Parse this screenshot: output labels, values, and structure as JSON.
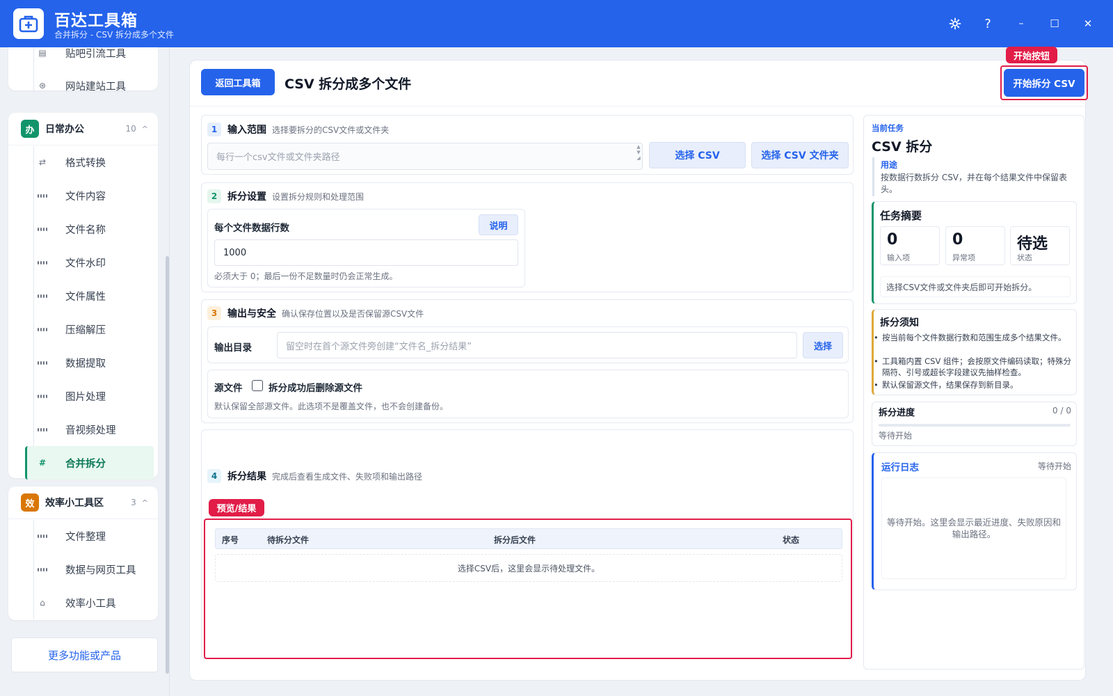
{
  "titlebar": {
    "title": "百达工具箱",
    "subtitle": "合并拆分 - CSV 拆分成多个文件",
    "help_label": "?",
    "minimize_label": "–",
    "maximize_label": "☐",
    "close_label": "✕"
  },
  "sidebar": {
    "top_group": {
      "items": [
        {
          "label": "贴吧引流工具"
        },
        {
          "label": "网站建站工具"
        }
      ]
    },
    "office_group": {
      "badge": "办",
      "title": "日常办公",
      "count": "10",
      "chevron": "^",
      "items": [
        {
          "label": "格式转换",
          "icon": "swap-icon"
        },
        {
          "label": "文件内容",
          "icon": "grid-icon"
        },
        {
          "label": "文件名称",
          "icon": "grid-icon"
        },
        {
          "label": "文件水印",
          "icon": "grid-icon"
        },
        {
          "label": "文件属性",
          "icon": "grid-icon"
        },
        {
          "label": "压缩解压",
          "icon": "grid-icon"
        },
        {
          "label": "数据提取",
          "icon": "grid-icon"
        },
        {
          "label": "图片处理",
          "icon": "grid-icon"
        },
        {
          "label": "音视频处理",
          "icon": "grid-icon"
        },
        {
          "label": "合并拆分",
          "icon": "hash-icon",
          "active": true
        }
      ]
    },
    "efficiency_group": {
      "badge": "效",
      "title": "效率小工具区",
      "count": "3",
      "chevron": "^",
      "items": [
        {
          "label": "文件整理",
          "icon": "grid-icon"
        },
        {
          "label": "数据与网页工具",
          "icon": "grid-icon"
        },
        {
          "label": "效率小工具",
          "icon": "toolbox-icon"
        }
      ]
    },
    "more_label": "更多功能或产品"
  },
  "header": {
    "back_label": "返回工具箱",
    "page_title": "CSV 拆分成多个文件",
    "start_label": "开始拆分 CSV",
    "start_tag": "开始按钮"
  },
  "sections": {
    "input": {
      "num": "1",
      "title": "输入范围",
      "desc": "选择要拆分的CSV文件或文件夹",
      "placeholder": "每行一个csv文件或文件夹路径",
      "select_csv": "选择 CSV",
      "select_folder": "选择 CSV 文件夹"
    },
    "settings": {
      "num": "2",
      "title": "拆分设置",
      "desc": "设置拆分规则和处理范围",
      "rows_label": "每个文件数据行数",
      "explain_label": "说明",
      "rows_value": "1000",
      "rows_hint": "必须大于 0；最后一份不足数量时仍会正常生成。"
    },
    "output": {
      "num": "3",
      "title": "输出与安全",
      "desc": "确认保存位置以及是否保留源CSV文件",
      "dir_label": "输出目录",
      "dir_placeholder": "留空时在首个源文件旁创建“文件名_拆分结果”",
      "choose_label": "选择",
      "source_label": "源文件",
      "delete_label": "拆分成功后删除源文件",
      "delete_checked": false,
      "source_hint": "默认保留全部源文件。此选项不是覆盖文件，也不会创建备份。"
    },
    "result": {
      "num": "4",
      "title": "拆分结果",
      "desc": "完成后查看生成文件、失败项和输出路径",
      "tag": "预览/结果",
      "columns": [
        "序号",
        "待拆分文件",
        "拆分后文件",
        "状态"
      ],
      "empty_text": "选择CSV后，这里会显示待处理文件。"
    }
  },
  "right_panel": {
    "current_task_label": "当前任务",
    "task_name": "CSV 拆分",
    "usage_label": "用途",
    "usage_text": "按数据行数拆分 CSV，并在每个结果文件中保留表头。",
    "summary": {
      "title": "任务摘要",
      "stats": [
        {
          "value": "0",
          "label": "输入项"
        },
        {
          "value": "0",
          "label": "异常项"
        },
        {
          "value": "待选",
          "label": "状态"
        }
      ],
      "note": "选择CSV文件或文件夹后即可开始拆分。"
    },
    "notice": {
      "title": "拆分须知",
      "bullets": [
        "按当前每个文件数据行数和范围生成多个结果文件。",
        "工具箱内置 CSV 组件；会按原文件编码读取；特殊分隔符、引号或超长字段建议先抽样检查。",
        "默认保留源文件，结果保存到新目录。"
      ]
    },
    "progress": {
      "title": "拆分进度",
      "count": "0 / 0",
      "fraction": 0,
      "status": "等待开始"
    },
    "log": {
      "title": "运行日志",
      "status": "等待开始",
      "placeholder": "等待开始。这里会显示最近进度、失败原因和输出路径。"
    }
  },
  "colors": {
    "brand_blue": "#2563eb",
    "highlight_red": "#e11d48",
    "active_green": "#12946b",
    "office_badge": "#12946b",
    "efficiency_badge": "#d97706"
  }
}
